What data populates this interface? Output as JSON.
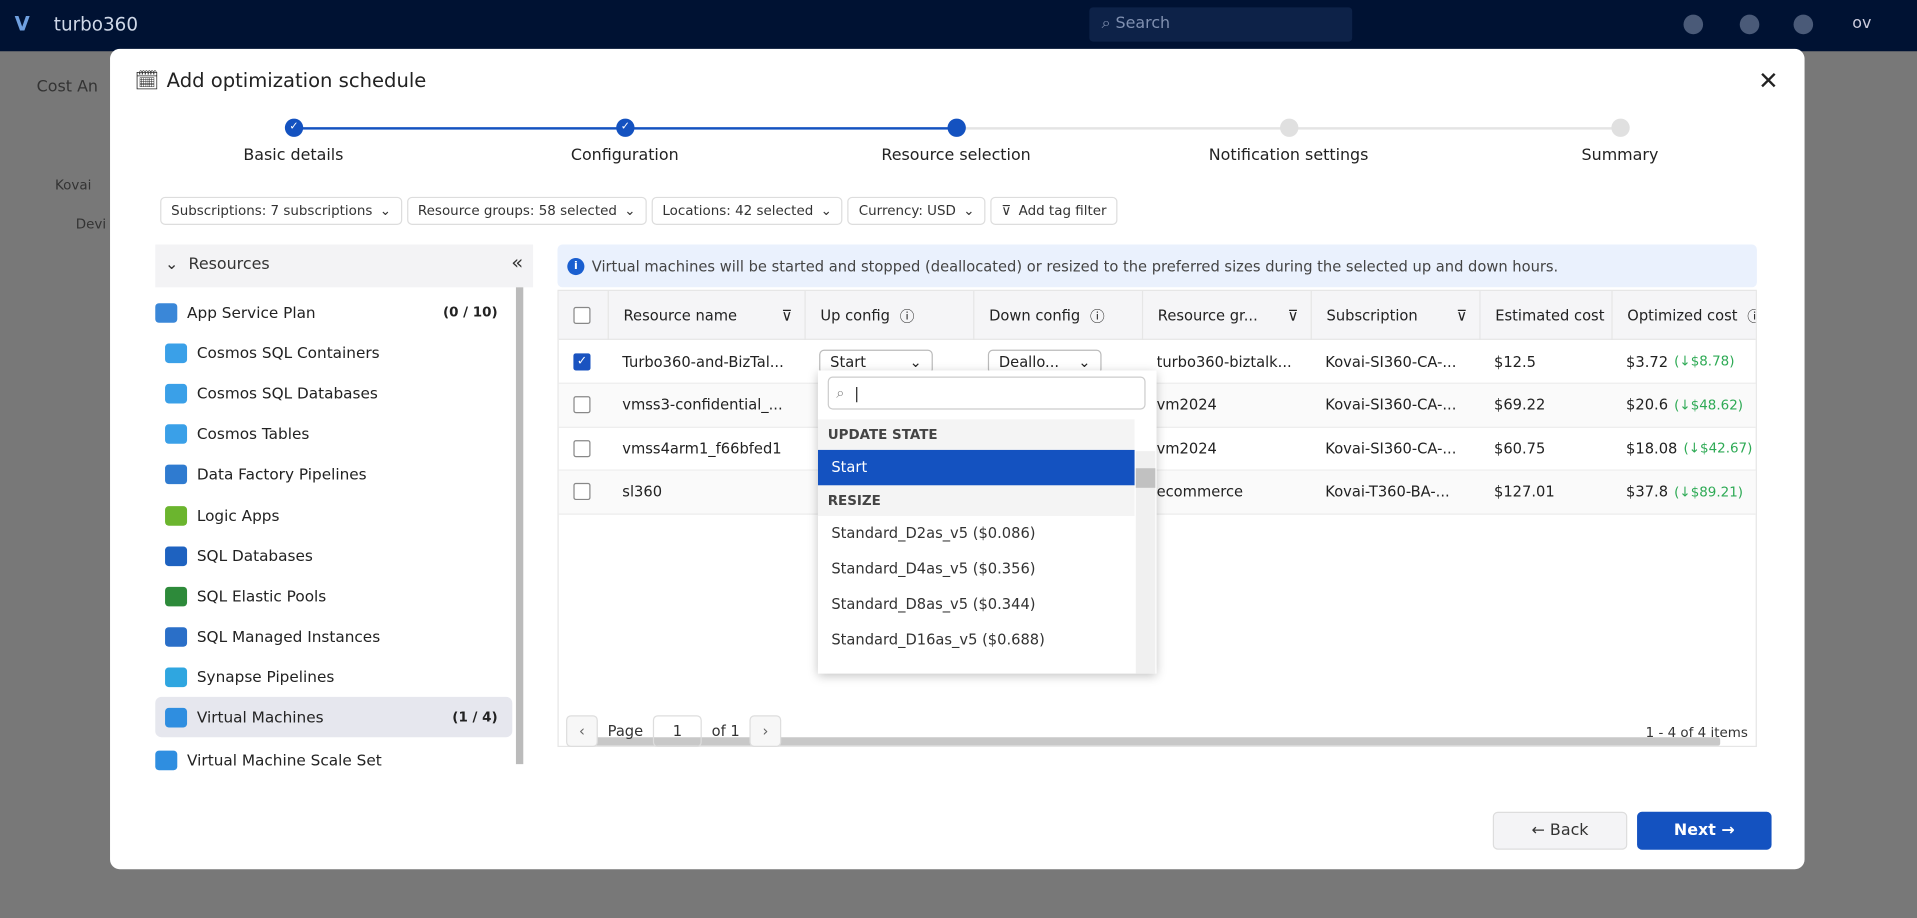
{
  "app": {
    "brand": "turbo360",
    "search_placeholder": "Search",
    "user_initials": "ov",
    "bg_page_title": "Cost An",
    "bg_tree": [
      "Kovai",
      "Devi"
    ]
  },
  "modal": {
    "title": "Add optimization schedule",
    "close": "✕"
  },
  "steps": [
    {
      "label": "Basic details",
      "state": "done"
    },
    {
      "label": "Configuration",
      "state": "done"
    },
    {
      "label": "Resource selection",
      "state": "active"
    },
    {
      "label": "Notification settings",
      "state": "pending"
    },
    {
      "label": "Summary",
      "state": "pending"
    }
  ],
  "filters": [
    "Subscriptions: 7 subscriptions",
    "Resource groups: 58 selected",
    "Locations: 42 selected",
    "Currency: USD",
    "Add tag filter"
  ],
  "sidebar": {
    "heading": "Resources",
    "items": [
      {
        "label": "App Service Plan",
        "count": "(0 / 10)",
        "icon": "app-service-plan-icon",
        "color": "#3a87d8"
      },
      {
        "label": "Cosmos SQL Containers",
        "icon": "cosmos-icon",
        "color": "#3aa0e8"
      },
      {
        "label": "Cosmos SQL Databases",
        "icon": "cosmos-icon",
        "color": "#3aa0e8"
      },
      {
        "label": "Cosmos Tables",
        "icon": "cosmos-icon",
        "color": "#3aa0e8"
      },
      {
        "label": "Data Factory Pipelines",
        "icon": "data-factory-icon",
        "color": "#2f7bd0"
      },
      {
        "label": "Logic Apps",
        "icon": "logic-apps-icon",
        "color": "#6bb52e"
      },
      {
        "label": "SQL Databases",
        "icon": "sql-database-icon",
        "color": "#1e62c0"
      },
      {
        "label": "SQL Elastic Pools",
        "icon": "sql-elastic-pool-icon",
        "color": "#2d8a3a"
      },
      {
        "label": "SQL Managed Instances",
        "icon": "sql-managed-instance-icon",
        "color": "#2a6fc8"
      },
      {
        "label": "Synapse Pipelines",
        "icon": "synapse-icon",
        "color": "#2fa6e0"
      },
      {
        "label": "Virtual Machines",
        "count": "(1 / 4)",
        "icon": "virtual-machine-icon",
        "color": "#2f8ee0",
        "selected": true
      },
      {
        "label": "Virtual Machine Scale Set",
        "icon": "vmss-icon",
        "color": "#2f8ee0"
      }
    ]
  },
  "info": "Virtual machines will be started and stopped (deallocated) or resized to the preferred sizes during the selected up and down hours.",
  "table": {
    "columns": [
      "Resource name",
      "Up config",
      "Down config",
      "Resource gr...",
      "Subscription",
      "Estimated cost",
      "Optimized cost"
    ],
    "rows": [
      {
        "checked": true,
        "name": "Turbo360-and-BizTal...",
        "up": "Start",
        "down": "Deallo...",
        "rg": "turbo360-biztalk...",
        "sub": "Kovai-SI360-CA-...",
        "est": "$12.5",
        "opt": "$3.72",
        "save": "(↓$8.78)"
      },
      {
        "checked": false,
        "name": "vmss3-confidential_...",
        "rg": "vm2024",
        "sub": "Kovai-SI360-CA-...",
        "est": "$69.22",
        "opt": "$20.6",
        "save": "(↓$48.62)"
      },
      {
        "checked": false,
        "name": "vmss4arm1_f66bfed1",
        "rg": "vm2024",
        "sub": "Kovai-SI360-CA-...",
        "est": "$60.75",
        "opt": "$18.08",
        "save": "(↓$42.67)"
      },
      {
        "checked": false,
        "name": "sl360",
        "rg": "ecommerce",
        "sub": "Kovai-T360-BA-...",
        "est": "$127.01",
        "opt": "$37.8",
        "save": "(↓$89.21)"
      }
    ]
  },
  "dropdown": {
    "search_value": "",
    "groups": [
      {
        "label": "UPDATE STATE",
        "options": [
          "Start"
        ]
      },
      {
        "label": "RESIZE",
        "options": [
          "Standard_D2as_v5 ($0.086)",
          "Standard_D4as_v5 ($0.356)",
          "Standard_D8as_v5 ($0.344)",
          "Standard_D16as_v5 ($0.688)"
        ]
      }
    ],
    "selected": "Start"
  },
  "pager": {
    "page_label": "Page",
    "page": "1",
    "of": "of 1",
    "summary": "1 - 4 of 4 items"
  },
  "buttons": {
    "back": "← Back",
    "next": "Next →"
  },
  "colors": {
    "primary": "#1452c0",
    "savings": "#2eaa55",
    "topbar": "#001233"
  }
}
